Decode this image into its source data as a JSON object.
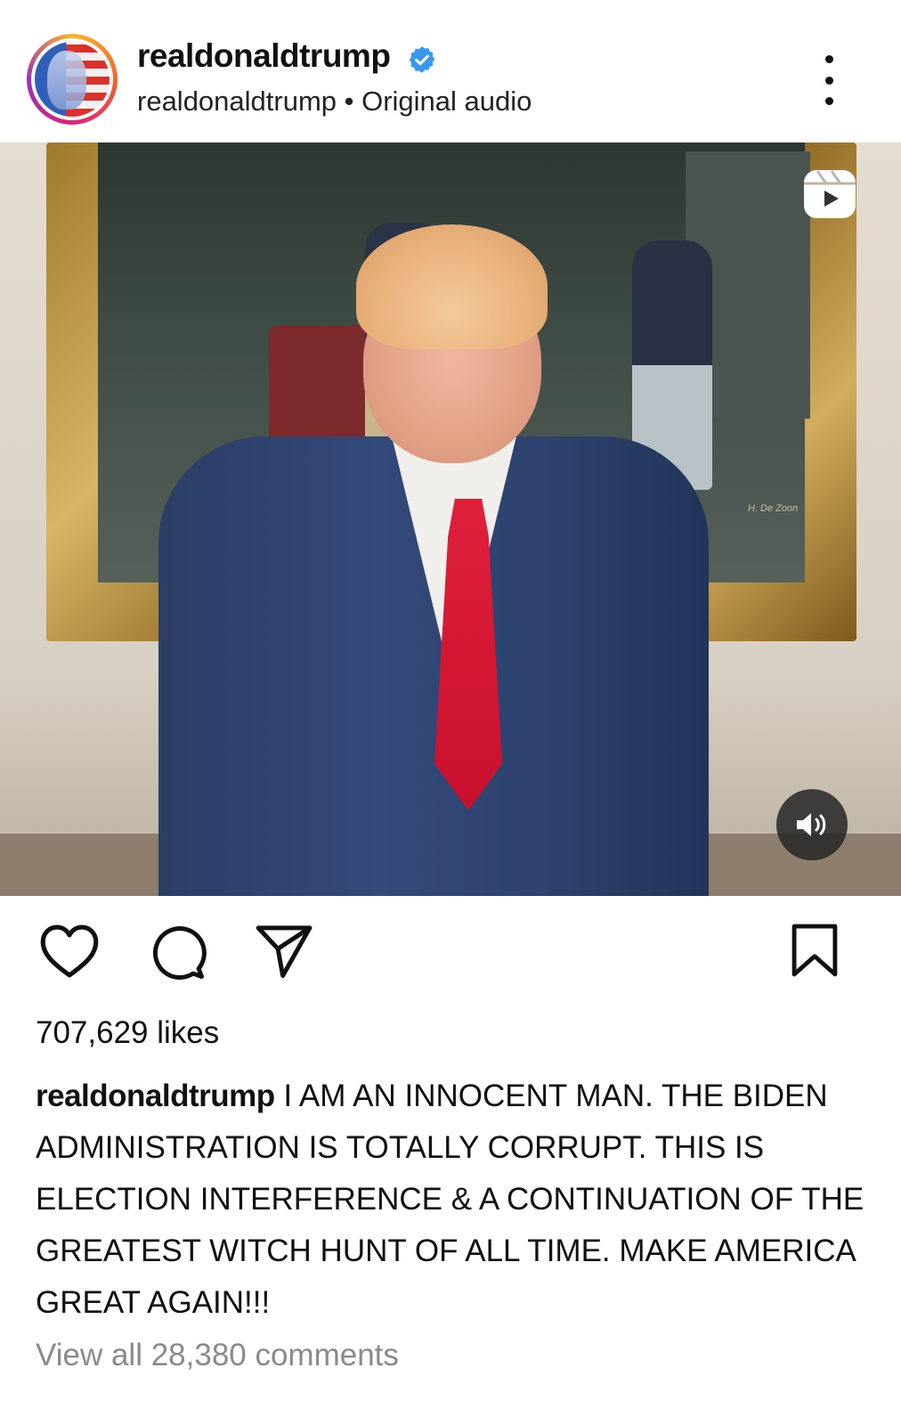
{
  "header": {
    "username": "realdonaldtrump",
    "subline": "realdonaldtrump • Original audio",
    "verified": true
  },
  "media": {
    "type": "reel-video",
    "painting_signature": "H. De Zoon"
  },
  "icons": {
    "verified": "verified-badge-icon",
    "more": "more-options-icon",
    "reels": "reels-icon",
    "sound": "speaker-icon",
    "like": "heart-icon",
    "comment": "comment-bubble-icon",
    "share": "paper-plane-icon",
    "save": "bookmark-icon"
  },
  "colors": {
    "verified_blue": "#3897f0",
    "text": "#111111",
    "muted": "#8a8a8a"
  },
  "engagement": {
    "likes": "707,629 likes",
    "view_comments": "View all 28,380 comments"
  },
  "caption": {
    "username": "realdonaldtrump",
    "text": "I AM AN INNOCENT MAN. THE BIDEN ADMINISTRATION IS TOTALLY CORRUPT. THIS IS ELECTION INTERFERENCE & A CONTINUATION OF THE GREATEST WITCH HUNT OF ALL TIME. MAKE AMERICA GREAT AGAIN!!!"
  }
}
